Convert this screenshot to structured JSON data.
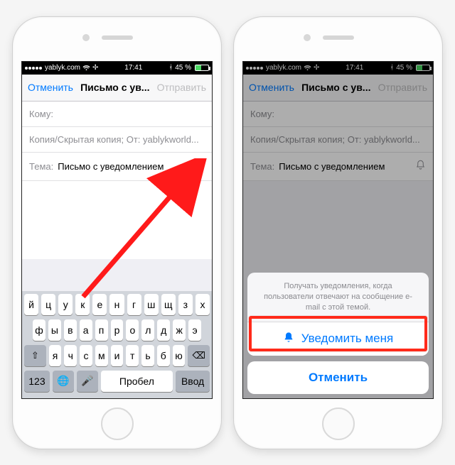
{
  "status": {
    "carrier": "yablyk.com",
    "time": "17:41",
    "battery_text": "45 %"
  },
  "nav": {
    "cancel": "Отменить",
    "title": "Письмо с ув...",
    "send": "Отправить"
  },
  "fields": {
    "to_label": "Кому:",
    "cc_line": "Копия/Скрытая копия; От: yablykworld...",
    "subject_label": "Тема:",
    "subject_value": "Письмо с уведомлением"
  },
  "keyboard": {
    "row1": [
      "й",
      "ц",
      "у",
      "к",
      "е",
      "н",
      "г",
      "ш",
      "щ",
      "з",
      "х"
    ],
    "row2": [
      "ф",
      "ы",
      "в",
      "а",
      "п",
      "р",
      "о",
      "л",
      "д",
      "ж",
      "э"
    ],
    "row3": [
      "я",
      "ч",
      "с",
      "м",
      "и",
      "т",
      "ь",
      "б",
      "ю"
    ],
    "k123": "123",
    "space": "Пробел",
    "enter": "Ввод"
  },
  "sheet": {
    "message": "Получать уведомления, когда пользователи отвечают на сообщение e-mail с этой темой.",
    "notify": "Уведомить меня",
    "cancel": "Отменить"
  }
}
